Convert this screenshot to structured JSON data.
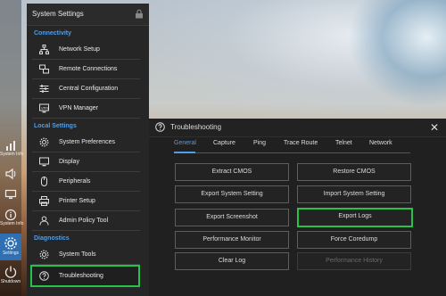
{
  "colors": {
    "accent": "#4f9ee6",
    "highlight": "#27c24a",
    "panel": "#262626"
  },
  "iconbar": {
    "items": [
      {
        "name": "system-info",
        "label": "System Info",
        "icon": "signal-bars-icon"
      },
      {
        "name": "volume",
        "label": "",
        "icon": "speaker-icon"
      },
      {
        "name": "display",
        "label": "",
        "icon": "monitor-icon"
      },
      {
        "name": "info",
        "label": "System Info",
        "icon": "info-icon"
      },
      {
        "name": "settings",
        "label": "Settings",
        "icon": "gear-icon"
      },
      {
        "name": "shutdown",
        "label": "Shutdown",
        "icon": "power-icon"
      }
    ]
  },
  "settings": {
    "title": "System Settings",
    "sections": [
      {
        "title": "Connectivity",
        "items": [
          "Network Setup",
          "Remote Connections",
          "Central Configuration",
          "VPN Manager"
        ]
      },
      {
        "title": "Local Settings",
        "items": [
          "System Preferences",
          "Display",
          "Peripherals",
          "Printer Setup",
          "Admin Policy Tool"
        ]
      },
      {
        "title": "Diagnostics",
        "items": [
          "System Tools",
          "Troubleshooting"
        ]
      }
    ]
  },
  "dialog": {
    "title": "Troubleshooting",
    "close": "✕",
    "tabs": [
      "General",
      "Capture",
      "Ping",
      "Trace Route",
      "Telnet",
      "Network"
    ],
    "active_tab": "General",
    "buttons": [
      "Extract CMOS",
      "Restore CMOS",
      "Export System Setting",
      "Import System Setting",
      "Export Screenshot",
      "Export Logs",
      "Performance Monitor",
      "Force Coredump",
      "Clear Log",
      "Performance History"
    ]
  }
}
